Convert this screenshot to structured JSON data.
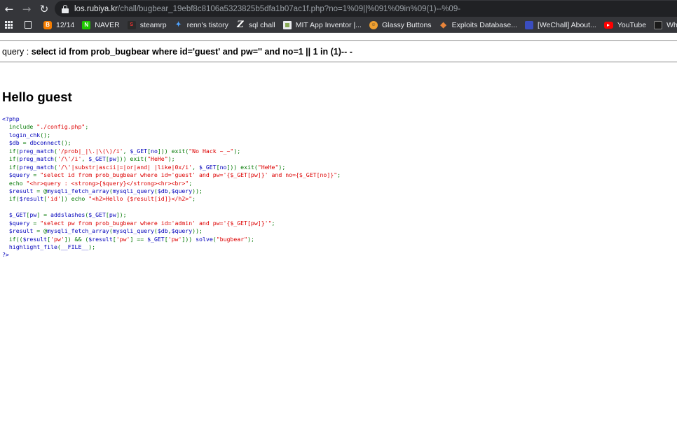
{
  "browser": {
    "url_host": "los.rubiya.kr",
    "url_path": "/chall/bugbear_19ebf8c8106a5323825b5dfa1b07ac1f.php?no=1%09||%091%09in%09(1)--%09-"
  },
  "bookmarks": [
    {
      "label": "",
      "icon": "apps-icon"
    },
    {
      "label": "",
      "icon": "document-icon"
    },
    {
      "label": "12/14",
      "icon": "blogger-icon"
    },
    {
      "label": "NAVER",
      "icon": "naver-icon"
    },
    {
      "label": "steamrp",
      "icon": "steamrp-icon"
    },
    {
      "label": "renn's tistory",
      "icon": "tistory-icon"
    },
    {
      "label": "sql chall",
      "icon": "z-icon"
    },
    {
      "label": "MIT App Inventor |...",
      "icon": "mit-icon"
    },
    {
      "label": "Glassy Buttons",
      "icon": "glassy-icon"
    },
    {
      "label": "Exploits Database...",
      "icon": "exploit-db-icon"
    },
    {
      "label": "[WeChall] About...",
      "icon": "wechall-icon"
    },
    {
      "label": "YouTube",
      "icon": "youtube-icon"
    },
    {
      "label": "Whats My IP A",
      "icon": "whatsmyip-icon"
    }
  ],
  "page": {
    "query_prefix": "query : ",
    "query_text": "select id from prob_bugbear where id='guest' and pw='' and no=1 || 1 in (1)-- -",
    "hello_heading": "Hello guest"
  },
  "source_code": [
    [
      [
        "d",
        "<?php"
      ]
    ],
    [
      [
        "d",
        "  "
      ],
      [
        "k",
        "include "
      ],
      [
        "s",
        "\"./config.php\""
      ],
      [
        "k",
        ";"
      ]
    ],
    [
      [
        "d",
        "  login_chk"
      ],
      [
        "k",
        "();"
      ]
    ],
    [
      [
        "d",
        "  $db "
      ],
      [
        "k",
        "= "
      ],
      [
        "d",
        "dbconnect"
      ],
      [
        "k",
        "();"
      ]
    ],
    [
      [
        "k",
        "  if("
      ],
      [
        "d",
        "preg_match"
      ],
      [
        "k",
        "("
      ],
      [
        "s",
        "'/prob|_|\\.|\\(\\)/i'"
      ],
      [
        "k",
        ", "
      ],
      [
        "d",
        "$_GET"
      ],
      [
        "k",
        "["
      ],
      [
        "d",
        "no"
      ],
      [
        "k",
        "])) exit("
      ],
      [
        "s",
        "\"No Hack ~_~\""
      ],
      [
        "k",
        ");"
      ]
    ],
    [
      [
        "k",
        "  if("
      ],
      [
        "d",
        "preg_match"
      ],
      [
        "k",
        "("
      ],
      [
        "s",
        "'/\\'/i'"
      ],
      [
        "k",
        ", "
      ],
      [
        "d",
        "$_GET"
      ],
      [
        "k",
        "["
      ],
      [
        "d",
        "pw"
      ],
      [
        "k",
        "])) exit("
      ],
      [
        "s",
        "\"HeHe\""
      ],
      [
        "k",
        ");"
      ]
    ],
    [
      [
        "k",
        "  if("
      ],
      [
        "d",
        "preg_match"
      ],
      [
        "k",
        "("
      ],
      [
        "s",
        "'/\\'|substr|ascii|=|or|and| |like|0x/i'"
      ],
      [
        "k",
        ", "
      ],
      [
        "d",
        "$_GET"
      ],
      [
        "k",
        "["
      ],
      [
        "d",
        "no"
      ],
      [
        "k",
        "])) exit("
      ],
      [
        "s",
        "\"HeHe\""
      ],
      [
        "k",
        ");"
      ]
    ],
    [
      [
        "d",
        "  $query "
      ],
      [
        "k",
        "= "
      ],
      [
        "s",
        "\"select id from prob_bugbear where id='guest' and pw='{$_GET[pw]}' and no={$_GET[no]}\""
      ],
      [
        "k",
        ";"
      ]
    ],
    [
      [
        "k",
        "  echo "
      ],
      [
        "s",
        "\"<hr>query : <strong>{$query}</strong><hr><br>\""
      ],
      [
        "k",
        ";"
      ]
    ],
    [
      [
        "d",
        "  $result "
      ],
      [
        "k",
        "= @"
      ],
      [
        "d",
        "mysqli_fetch_array"
      ],
      [
        "k",
        "("
      ],
      [
        "d",
        "mysqli_query"
      ],
      [
        "k",
        "("
      ],
      [
        "d",
        "$db"
      ],
      [
        "k",
        ","
      ],
      [
        "d",
        "$query"
      ],
      [
        "k",
        "));"
      ]
    ],
    [
      [
        "k",
        "  if("
      ],
      [
        "d",
        "$result"
      ],
      [
        "k",
        "["
      ],
      [
        "s",
        "'id'"
      ],
      [
        "k",
        "]) echo "
      ],
      [
        "s",
        "\"<h2>Hello {$result[id]}</h2>\""
      ],
      [
        "k",
        ";"
      ]
    ],
    [
      [
        "d",
        ""
      ]
    ],
    [
      [
        "d",
        "  $_GET"
      ],
      [
        "k",
        "["
      ],
      [
        "d",
        "pw"
      ],
      [
        "k",
        "] = "
      ],
      [
        "d",
        "addslashes"
      ],
      [
        "k",
        "("
      ],
      [
        "d",
        "$_GET"
      ],
      [
        "k",
        "["
      ],
      [
        "d",
        "pw"
      ],
      [
        "k",
        "]);"
      ]
    ],
    [
      [
        "d",
        "  $query "
      ],
      [
        "k",
        "= "
      ],
      [
        "s",
        "\"select pw from prob_bugbear where id='admin' and pw='{$_GET[pw]}'\""
      ],
      [
        "k",
        ";"
      ]
    ],
    [
      [
        "d",
        "  $result "
      ],
      [
        "k",
        "= @"
      ],
      [
        "d",
        "mysqli_fetch_array"
      ],
      [
        "k",
        "("
      ],
      [
        "d",
        "mysqli_query"
      ],
      [
        "k",
        "("
      ],
      [
        "d",
        "$db"
      ],
      [
        "k",
        ","
      ],
      [
        "d",
        "$query"
      ],
      [
        "k",
        "));"
      ]
    ],
    [
      [
        "k",
        "  if(("
      ],
      [
        "d",
        "$result"
      ],
      [
        "k",
        "["
      ],
      [
        "s",
        "'pw'"
      ],
      [
        "k",
        "]) && ("
      ],
      [
        "d",
        "$result"
      ],
      [
        "k",
        "["
      ],
      [
        "s",
        "'pw'"
      ],
      [
        "k",
        "] == "
      ],
      [
        "d",
        "$_GET"
      ],
      [
        "k",
        "["
      ],
      [
        "s",
        "'pw'"
      ],
      [
        "k",
        "])) "
      ],
      [
        "d",
        "solve"
      ],
      [
        "k",
        "("
      ],
      [
        "s",
        "\"bugbear\""
      ],
      [
        "k",
        ");"
      ]
    ],
    [
      [
        "d",
        "  highlight_file"
      ],
      [
        "k",
        "("
      ],
      [
        "d",
        "__FILE__"
      ],
      [
        "k",
        ");"
      ]
    ],
    [
      [
        "d",
        "?>"
      ]
    ]
  ],
  "colors": {
    "keyword": "#007700",
    "default": "#0000bb",
    "string": "#dd0000"
  }
}
